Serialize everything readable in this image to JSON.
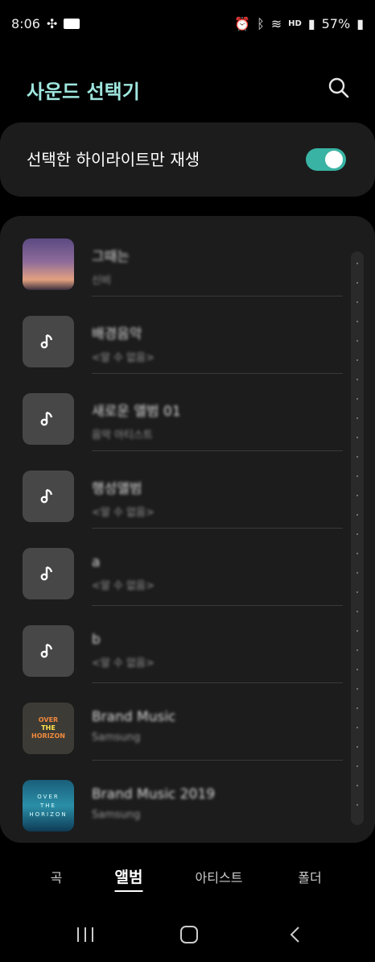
{
  "status": {
    "time": "8:06",
    "battery": "57%",
    "network": "HD"
  },
  "header": {
    "title": "사운드 선택기",
    "search_icon": "search-icon"
  },
  "highlight": {
    "label": "선택한 하이라이트만 재생",
    "enabled": true,
    "accent": "#39b3a3"
  },
  "albums": [
    {
      "title": "그때는",
      "subtitle": "신비",
      "thumb": "photo"
    },
    {
      "title": "배경음악",
      "subtitle": "<알 수 없음>",
      "thumb": "note"
    },
    {
      "title": "새로운 앨범 01",
      "subtitle": "음악 아티스트",
      "thumb": "note"
    },
    {
      "title": "행성앨범",
      "subtitle": "<알 수 없음>",
      "thumb": "note"
    },
    {
      "title": "a",
      "subtitle": "<알 수 없음>",
      "thumb": "note"
    },
    {
      "title": "b",
      "subtitle": "<알 수 없음>",
      "thumb": "note"
    },
    {
      "title": "Brand Music",
      "subtitle": "Samsung",
      "thumb": "over",
      "art_text": [
        "OVER",
        "THE",
        "HORIZON"
      ]
    },
    {
      "title": "Brand Music 2019",
      "subtitle": "Samsung",
      "thumb": "ocean",
      "art_text": [
        "OVER",
        "THE",
        "HORIZON"
      ]
    }
  ],
  "tabs": [
    {
      "label": "곡",
      "active": false
    },
    {
      "label": "앨범",
      "active": true
    },
    {
      "label": "아티스트",
      "active": false
    },
    {
      "label": "폴더",
      "active": false
    }
  ]
}
